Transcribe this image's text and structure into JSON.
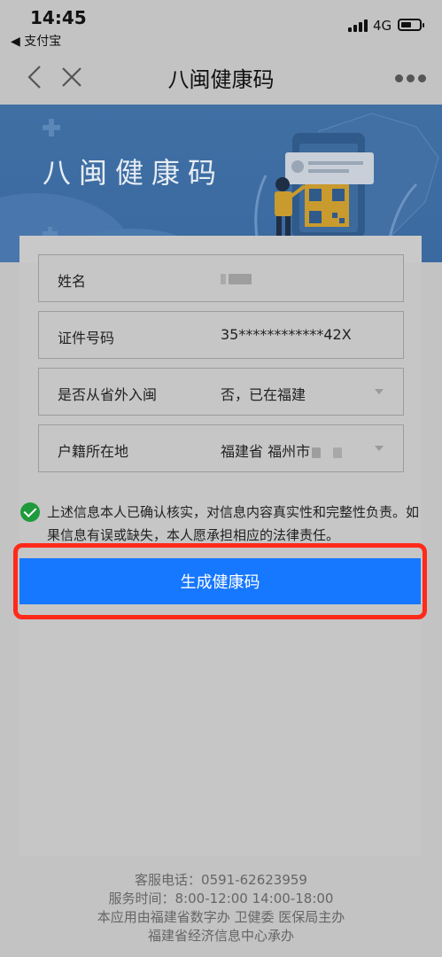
{
  "status_bar": {
    "time": "14:45",
    "back_app": "◀ 支付宝",
    "network": "4G"
  },
  "nav": {
    "title": "八闽健康码"
  },
  "banner": {
    "title": "八闽健康码"
  },
  "form": {
    "fields": [
      {
        "label": "姓名",
        "value": ""
      },
      {
        "label": "证件号码",
        "value": "35************42X"
      },
      {
        "label": "是否从省外入闽",
        "value": "否，已在福建"
      },
      {
        "label": "户籍所在地",
        "value": "福建省 福州市"
      }
    ]
  },
  "confirm": {
    "text": "上述信息本人已确认核实，对信息内容真实性和完整性负责。如果信息有误或缺失，本人愿承担相应的法律责任。"
  },
  "generate_button": {
    "label": "生成健康码"
  },
  "footer": {
    "lines": [
      "客服电话：0591-62623959",
      "服务时间：8:00-12:00 14:00-18:00",
      "本应用由福建省数字办 卫健委 医保局主办",
      "福建省经济信息中心承办"
    ]
  },
  "colors": {
    "primary_button": "#1677ff",
    "highlight_border": "#ff2a1a",
    "check_green": "#1f9a3c",
    "banner_blue": "#3f6fa3"
  }
}
